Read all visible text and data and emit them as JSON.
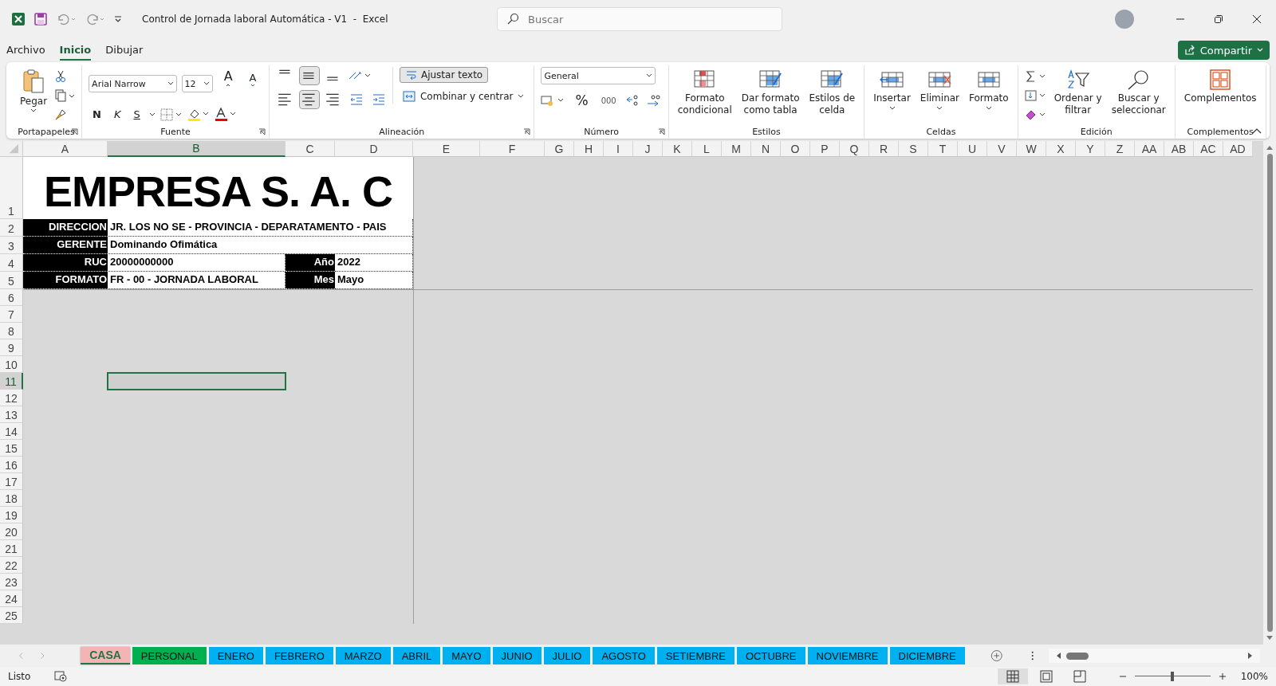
{
  "title_bar": {
    "title": "Control de Jornada laboral Automática - V1  -  Excel",
    "search": {
      "placeholder": "Buscar"
    }
  },
  "menu_tabs": [
    {
      "label": "Archivo",
      "selected": false
    },
    {
      "label": "Inicio",
      "selected": true
    },
    {
      "label": "Dibujar",
      "selected": false
    }
  ],
  "share_button": {
    "label": "Compartir"
  },
  "ribbon": {
    "clipboard": {
      "paste": "Pegar",
      "label": "Portapapeles"
    },
    "font": {
      "name": "Arial Narrow",
      "size": "12",
      "grow": "A",
      "shrink": "A",
      "bold": "N",
      "italic": "K",
      "underline": "S",
      "label": "Fuente"
    },
    "alignment": {
      "buttons": [
        {
          "kind": "top",
          "selected": false
        },
        {
          "kind": "middle",
          "selected": true
        },
        {
          "kind": "bottom",
          "selected": false
        },
        {
          "kind": "left",
          "selected": false
        },
        {
          "kind": "center",
          "selected": true
        },
        {
          "kind": "right",
          "selected": false
        }
      ],
      "wrap": {
        "label": "Ajustar texto",
        "on": true
      },
      "merge": "Combinar y centrar",
      "label": "Alineación"
    },
    "number": {
      "format": "General",
      "percent": "%",
      "thousands": "000",
      "label": "Número"
    },
    "styles": {
      "buttons": [
        "Formato\ncondicional",
        "Dar formato\ncomo tabla",
        "Estilos de\ncelda"
      ],
      "label": "Estilos"
    },
    "cells": {
      "buttons": [
        "Insertar",
        "Eliminar",
        "Formato"
      ],
      "label": "Celdas"
    },
    "editing": {
      "buttons": [
        "Ordenar y\nfiltrar",
        "Buscar y\nseleccionar"
      ],
      "label": "Edición"
    },
    "addins": {
      "buttons": [
        "Complementos"
      ],
      "label": "Complementos"
    }
  },
  "sheet": {
    "columns": [
      {
        "label": "A",
        "selected": false
      },
      {
        "label": "B",
        "selected": true
      },
      {
        "label": "C",
        "selected": false
      },
      {
        "label": "D",
        "selected": false
      },
      {
        "label": "E",
        "selected": false
      },
      {
        "label": "F",
        "selected": false
      },
      {
        "label": "G",
        "selected": false
      },
      {
        "label": "H",
        "selected": false
      },
      {
        "label": "I",
        "selected": false
      },
      {
        "label": "J",
        "selected": false
      },
      {
        "label": "K",
        "selected": false
      },
      {
        "label": "L",
        "selected": false
      },
      {
        "label": "M",
        "selected": false
      },
      {
        "label": "N",
        "selected": false
      },
      {
        "label": "O",
        "selected": false
      },
      {
        "label": "P",
        "selected": false
      },
      {
        "label": "Q",
        "selected": false
      },
      {
        "label": "R",
        "selected": false
      },
      {
        "label": "S",
        "selected": false
      },
      {
        "label": "T",
        "selected": false
      },
      {
        "label": "U",
        "selected": false
      },
      {
        "label": "V",
        "selected": false
      },
      {
        "label": "W",
        "selected": false
      },
      {
        "label": "X",
        "selected": false
      },
      {
        "label": "Y",
        "selected": false
      },
      {
        "label": "Z",
        "selected": false
      },
      {
        "label": "AA",
        "selected": false
      },
      {
        "label": "AB",
        "selected": false
      },
      {
        "label": "AC",
        "selected": false
      },
      {
        "label": "AD",
        "selected": false
      }
    ],
    "rows": [
      {
        "label": "1",
        "selected": false
      },
      {
        "label": "2",
        "selected": false
      },
      {
        "label": "3",
        "selected": false
      },
      {
        "label": "4",
        "selected": false
      },
      {
        "label": "5",
        "selected": false
      },
      {
        "label": "6",
        "selected": false
      },
      {
        "label": "7",
        "selected": false
      },
      {
        "label": "8",
        "selected": false
      },
      {
        "label": "9",
        "selected": false
      },
      {
        "label": "10",
        "selected": false
      },
      {
        "label": "11",
        "selected": true
      },
      {
        "label": "12",
        "selected": false
      },
      {
        "label": "13",
        "selected": false
      },
      {
        "label": "14",
        "selected": false
      },
      {
        "label": "15",
        "selected": false
      },
      {
        "label": "16",
        "selected": false
      },
      {
        "label": "17",
        "selected": false
      },
      {
        "label": "18",
        "selected": false
      },
      {
        "label": "19",
        "selected": false
      },
      {
        "label": "20",
        "selected": false
      },
      {
        "label": "21",
        "selected": false
      },
      {
        "label": "22",
        "selected": false
      },
      {
        "label": "23",
        "selected": false
      },
      {
        "label": "24",
        "selected": false
      },
      {
        "label": "25",
        "selected": false
      }
    ],
    "title": "EMPRESA S. A. C",
    "info": [
      {
        "label": "DIRECCION",
        "value": "JR. LOS NO SE - PROVINCIA - DEPARATAMENTO - PAIS"
      },
      {
        "label": "GERENTE",
        "value": "Dominando Ofimática"
      },
      {
        "label": "RUC",
        "value": "20000000000",
        "label_2": "Año",
        "value_2": "2022"
      },
      {
        "label": "FORMATO",
        "value": "FR - 00 - JORNADA LABORAL",
        "label_2": "Mes",
        "value_2": "Mayo"
      }
    ]
  },
  "sheet_tabs": [
    {
      "label": "CASA",
      "color": "#f4b4b4",
      "selected": true
    },
    {
      "label": "PERSONAL",
      "color": "#00b050",
      "selected": false
    },
    {
      "label": "ENERO",
      "color": "#00b0f0",
      "selected": false
    },
    {
      "label": "FEBRERO",
      "color": "#00b0f0",
      "selected": false
    },
    {
      "label": "MARZO",
      "color": "#00b0f0",
      "selected": false
    },
    {
      "label": "ABRIL",
      "color": "#00b0f0",
      "selected": false
    },
    {
      "label": "MAYO",
      "color": "#00b0f0",
      "selected": false
    },
    {
      "label": "JUNIO",
      "color": "#00b0f0",
      "selected": false
    },
    {
      "label": "JULIO",
      "color": "#00b0f0",
      "selected": false
    },
    {
      "label": "AGOSTO",
      "color": "#00b0f0",
      "selected": false
    },
    {
      "label": "SETIEMBRE",
      "color": "#00b0f0",
      "selected": false
    },
    {
      "label": "OCTUBRE",
      "color": "#00b0f0",
      "selected": false
    },
    {
      "label": "NOVIEMBRE",
      "color": "#00b0f0",
      "selected": false
    },
    {
      "label": "DICIEMBRE",
      "color": "#00b0f0",
      "selected": false
    }
  ],
  "status_bar": {
    "status": "Listo",
    "views": [
      {
        "kind": "normal",
        "selected": true
      },
      {
        "kind": "page_layout",
        "selected": false
      },
      {
        "kind": "page_break",
        "selected": false
      }
    ],
    "zoom_slider": {
      "level": 0.5
    },
    "zoom": "100%"
  }
}
